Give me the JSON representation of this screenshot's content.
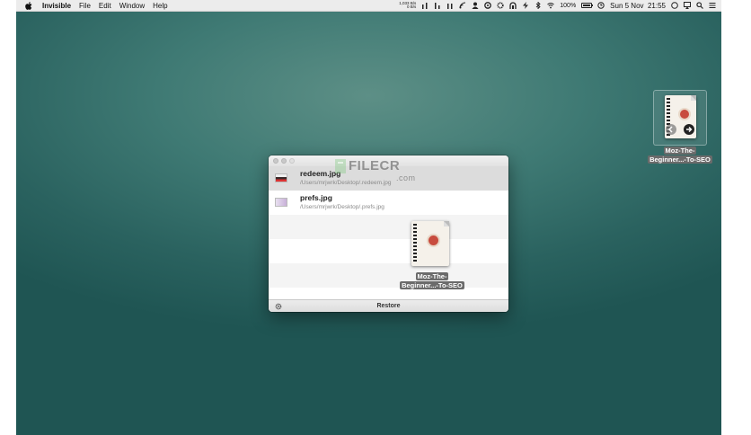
{
  "menubar": {
    "app_name": "Invisible",
    "menus": [
      "File",
      "Edit",
      "Window",
      "Help"
    ],
    "net_up": "1,033 B/s",
    "net_down": "0 B/s",
    "battery_percent": "100%",
    "battery_level": 1.0,
    "datetime": "Sun 5 Nov  21:55"
  },
  "window": {
    "files": [
      {
        "name": "redeem.jpg",
        "path": "/Users/mrjwrk/Desktop/.redeem.jpg"
      },
      {
        "name": "prefs.jpg",
        "path": "/Users/mrjwrk/Desktop/.prefs.jpg"
      }
    ],
    "restore_label": "Restore"
  },
  "drag_item": {
    "label_line1": "Moz-The-",
    "label_line2": "Beginner...-To-SEO"
  },
  "desktop_item": {
    "label_line1": "Moz-The-",
    "label_line2": "Beginner...-To-SEO"
  },
  "watermark": {
    "text": "FILECR",
    "suffix": ".com"
  },
  "colors": {
    "desktop": "#2f6b67",
    "selection": "#dcdcdc",
    "seal": "#c84c3e"
  }
}
